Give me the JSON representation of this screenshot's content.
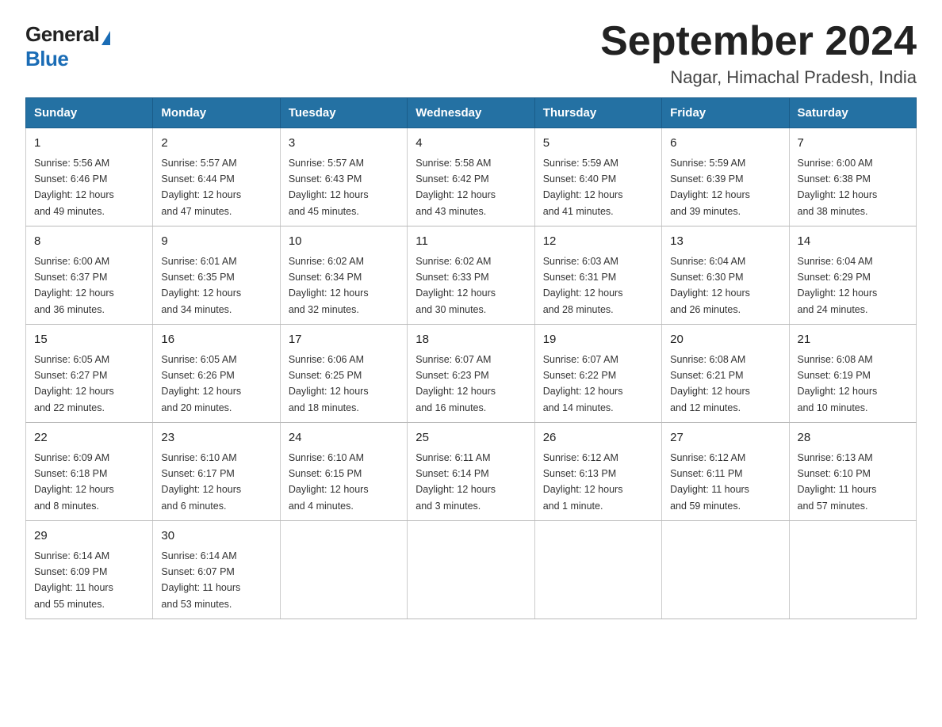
{
  "logo": {
    "general": "General",
    "blue": "Blue"
  },
  "title": "September 2024",
  "subtitle": "Nagar, Himachal Pradesh, India",
  "days_of_week": [
    "Sunday",
    "Monday",
    "Tuesday",
    "Wednesday",
    "Thursday",
    "Friday",
    "Saturday"
  ],
  "weeks": [
    [
      {
        "day": "1",
        "sunrise": "5:56 AM",
        "sunset": "6:46 PM",
        "daylight": "12 hours and 49 minutes."
      },
      {
        "day": "2",
        "sunrise": "5:57 AM",
        "sunset": "6:44 PM",
        "daylight": "12 hours and 47 minutes."
      },
      {
        "day": "3",
        "sunrise": "5:57 AM",
        "sunset": "6:43 PM",
        "daylight": "12 hours and 45 minutes."
      },
      {
        "day": "4",
        "sunrise": "5:58 AM",
        "sunset": "6:42 PM",
        "daylight": "12 hours and 43 minutes."
      },
      {
        "day": "5",
        "sunrise": "5:59 AM",
        "sunset": "6:40 PM",
        "daylight": "12 hours and 41 minutes."
      },
      {
        "day": "6",
        "sunrise": "5:59 AM",
        "sunset": "6:39 PM",
        "daylight": "12 hours and 39 minutes."
      },
      {
        "day": "7",
        "sunrise": "6:00 AM",
        "sunset": "6:38 PM",
        "daylight": "12 hours and 38 minutes."
      }
    ],
    [
      {
        "day": "8",
        "sunrise": "6:00 AM",
        "sunset": "6:37 PM",
        "daylight": "12 hours and 36 minutes."
      },
      {
        "day": "9",
        "sunrise": "6:01 AM",
        "sunset": "6:35 PM",
        "daylight": "12 hours and 34 minutes."
      },
      {
        "day": "10",
        "sunrise": "6:02 AM",
        "sunset": "6:34 PM",
        "daylight": "12 hours and 32 minutes."
      },
      {
        "day": "11",
        "sunrise": "6:02 AM",
        "sunset": "6:33 PM",
        "daylight": "12 hours and 30 minutes."
      },
      {
        "day": "12",
        "sunrise": "6:03 AM",
        "sunset": "6:31 PM",
        "daylight": "12 hours and 28 minutes."
      },
      {
        "day": "13",
        "sunrise": "6:04 AM",
        "sunset": "6:30 PM",
        "daylight": "12 hours and 26 minutes."
      },
      {
        "day": "14",
        "sunrise": "6:04 AM",
        "sunset": "6:29 PM",
        "daylight": "12 hours and 24 minutes."
      }
    ],
    [
      {
        "day": "15",
        "sunrise": "6:05 AM",
        "sunset": "6:27 PM",
        "daylight": "12 hours and 22 minutes."
      },
      {
        "day": "16",
        "sunrise": "6:05 AM",
        "sunset": "6:26 PM",
        "daylight": "12 hours and 20 minutes."
      },
      {
        "day": "17",
        "sunrise": "6:06 AM",
        "sunset": "6:25 PM",
        "daylight": "12 hours and 18 minutes."
      },
      {
        "day": "18",
        "sunrise": "6:07 AM",
        "sunset": "6:23 PM",
        "daylight": "12 hours and 16 minutes."
      },
      {
        "day": "19",
        "sunrise": "6:07 AM",
        "sunset": "6:22 PM",
        "daylight": "12 hours and 14 minutes."
      },
      {
        "day": "20",
        "sunrise": "6:08 AM",
        "sunset": "6:21 PM",
        "daylight": "12 hours and 12 minutes."
      },
      {
        "day": "21",
        "sunrise": "6:08 AM",
        "sunset": "6:19 PM",
        "daylight": "12 hours and 10 minutes."
      }
    ],
    [
      {
        "day": "22",
        "sunrise": "6:09 AM",
        "sunset": "6:18 PM",
        "daylight": "12 hours and 8 minutes."
      },
      {
        "day": "23",
        "sunrise": "6:10 AM",
        "sunset": "6:17 PM",
        "daylight": "12 hours and 6 minutes."
      },
      {
        "day": "24",
        "sunrise": "6:10 AM",
        "sunset": "6:15 PM",
        "daylight": "12 hours and 4 minutes."
      },
      {
        "day": "25",
        "sunrise": "6:11 AM",
        "sunset": "6:14 PM",
        "daylight": "12 hours and 3 minutes."
      },
      {
        "day": "26",
        "sunrise": "6:12 AM",
        "sunset": "6:13 PM",
        "daylight": "12 hours and 1 minute."
      },
      {
        "day": "27",
        "sunrise": "6:12 AM",
        "sunset": "6:11 PM",
        "daylight": "11 hours and 59 minutes."
      },
      {
        "day": "28",
        "sunrise": "6:13 AM",
        "sunset": "6:10 PM",
        "daylight": "11 hours and 57 minutes."
      }
    ],
    [
      {
        "day": "29",
        "sunrise": "6:14 AM",
        "sunset": "6:09 PM",
        "daylight": "11 hours and 55 minutes."
      },
      {
        "day": "30",
        "sunrise": "6:14 AM",
        "sunset": "6:07 PM",
        "daylight": "11 hours and 53 minutes."
      },
      null,
      null,
      null,
      null,
      null
    ]
  ],
  "labels": {
    "sunrise": "Sunrise:",
    "sunset": "Sunset:",
    "daylight": "Daylight:"
  }
}
